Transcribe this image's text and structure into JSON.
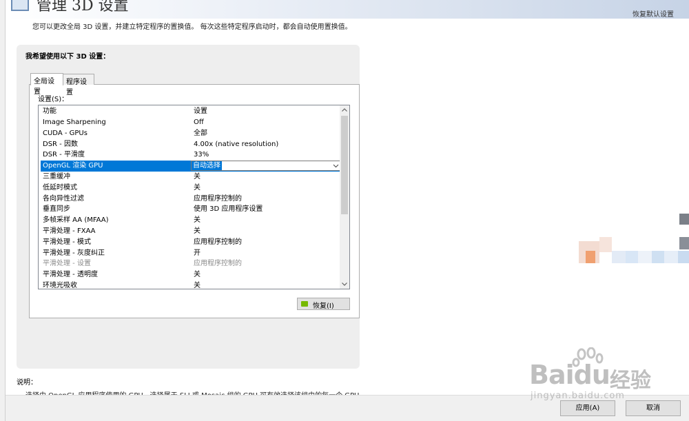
{
  "header": {
    "title": "管理 3D 设置",
    "restore_defaults": "恢复默认设置"
  },
  "intro": "您可以更改全局 3D 设置，并建立特定程序的置换值。 每次这些特定程序启动时，都会自动使用置换值。",
  "panel": {
    "heading": "我希望使用以下 3D 设置：",
    "tabs": [
      {
        "label": "全局设置",
        "active": true
      },
      {
        "label": "程序设置",
        "active": false
      }
    ],
    "settings_label": "设置(S)：",
    "columns": {
      "feature": "功能",
      "setting": "设置"
    },
    "rows": [
      {
        "feature": "Image Sharpening",
        "setting": "Off"
      },
      {
        "feature": "CUDA - GPUs",
        "setting": "全部"
      },
      {
        "feature": "DSR - 因数",
        "setting": "4.00x (native resolution)"
      },
      {
        "feature": "DSR - 平滑度",
        "setting": "33%"
      },
      {
        "feature": "OpenGL 渲染 GPU",
        "setting": "自动选择"
      },
      {
        "feature": "三重缓冲",
        "setting": "关"
      },
      {
        "feature": "低延时模式",
        "setting": "关"
      },
      {
        "feature": "各向异性过滤",
        "setting": "应用程序控制的"
      },
      {
        "feature": "垂直同步",
        "setting": "使用 3D 应用程序设置"
      },
      {
        "feature": "多帧采样 AA (MFAA)",
        "setting": "关"
      },
      {
        "feature": "平滑处理 - FXAA",
        "setting": "关"
      },
      {
        "feature": "平滑处理 - 模式",
        "setting": "应用程序控制的"
      },
      {
        "feature": "平滑处理 - 灰度纠正",
        "setting": "开"
      },
      {
        "feature": "平滑处理 - 设置",
        "setting": "应用程序控制的"
      },
      {
        "feature": "平滑处理 - 透明度",
        "setting": "关"
      },
      {
        "feature": "环境光吸收",
        "setting": "关"
      }
    ],
    "restore_button": "恢复(I)"
  },
  "description": {
    "label": "说明：",
    "text": "选择由 OpenGL 应用程序使用的 GPU。选择属于 SLI 或 Mosaic 组的 GPU 可有效选择该组中的每一个 GPU。"
  },
  "footer": {
    "apply": "应用(A)",
    "cancel": "取消"
  },
  "watermark": {
    "brand": "Bai",
    "brand_suffix": "du",
    "cn": "经验",
    "url": "jingyan.baidu.com"
  },
  "colors": {
    "selection": "#0078d7",
    "nvidia_green": "#76b900",
    "panel_bg": "#eeeeee"
  }
}
